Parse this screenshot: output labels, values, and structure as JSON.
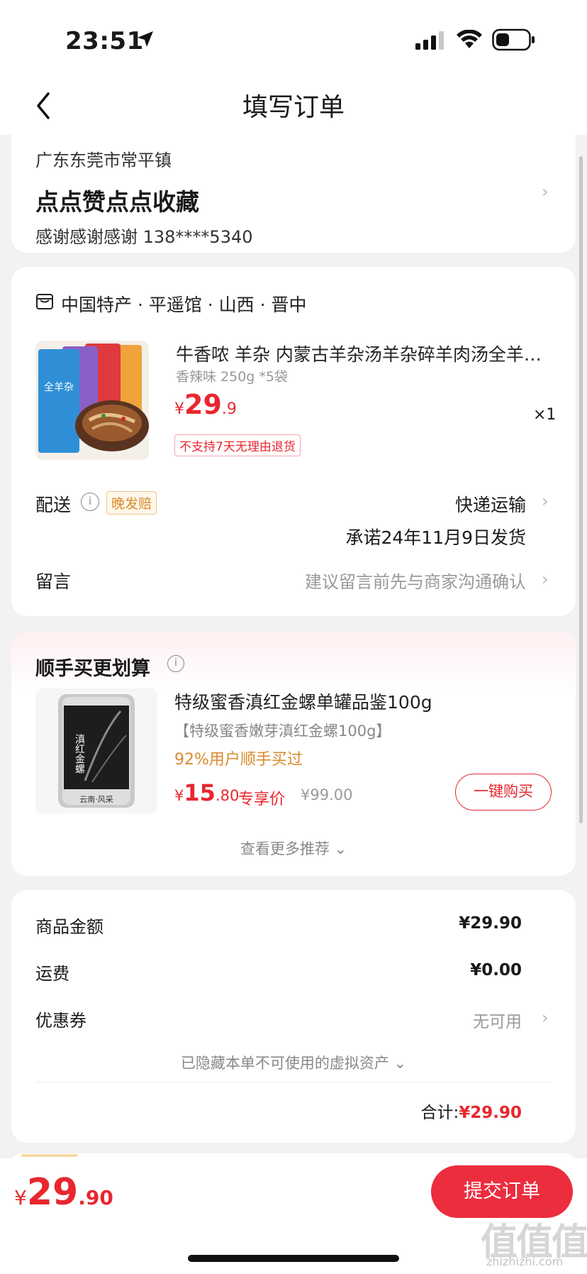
{
  "status": {
    "time": "23:51"
  },
  "nav": {
    "title": "填写订单"
  },
  "address": {
    "region": "广东东莞市常平镇",
    "detail": "点点赞点点收藏",
    "contact": "感谢感谢感谢  138****5340"
  },
  "shop": {
    "name": "中国特产 · 平遥馆 · 山西 · 晋中"
  },
  "product": {
    "title": "牛香哝 羊杂 内蒙古羊杂汤羊杂碎羊肉汤全羊汤熟食",
    "spec": "香辣味 250g *5袋",
    "price_currency": "¥",
    "price_int": "29",
    "price_dec": ".9",
    "qty": "×1",
    "no_return": "不支持7天无理由退货",
    "img_label": "全羊杂"
  },
  "delivery": {
    "label": "配送",
    "badge": "晚发赔",
    "method": "快递运输",
    "promise": "承诺24年11月9日发货",
    "info_glyph": "i"
  },
  "message": {
    "label": "留言",
    "hint": "建议留言前先与商家沟通确认"
  },
  "recommend": {
    "title": "顺手买更划算",
    "info_glyph": "i",
    "item_title": "特级蜜香滇红金螺单罐品鉴100g",
    "item_sub": "【特级蜜香嫩芽滇红金螺100g】",
    "item_users": "92%用户顺手买过",
    "price_currency": "¥",
    "price_int": "15",
    "price_dec": ".80",
    "price_tag": "专享价",
    "orig_price": "¥99.00",
    "buy_label": "一键购买",
    "more_label": "查看更多推荐 ⌄",
    "tin_text": "滇红金螺",
    "tin_sub": "云南·风采"
  },
  "summary": {
    "goods_label": "商品金额",
    "goods_value": "¥29.90",
    "shipping_label": "运费",
    "shipping_value": "¥0.00",
    "coupon_label": "优惠券",
    "coupon_value": "无可用",
    "hidden_assets": "已隐藏本单不可使用的虚拟资产 ⌄",
    "total_label": "合计:",
    "total_value": "¥29.90"
  },
  "bottom": {
    "price_currency": "¥",
    "price_int": "29",
    "price_dec": ".90",
    "submit_label": "提交订单"
  },
  "watermark": {
    "text": "值值值",
    "site": "zhizhizhi.com"
  },
  "icons": {
    "back": "chevron-left-icon",
    "chevron": "›"
  },
  "colors": {
    "accent": "#e8272f",
    "submit": "#ec2d3e",
    "badge": "#d98a2b"
  }
}
